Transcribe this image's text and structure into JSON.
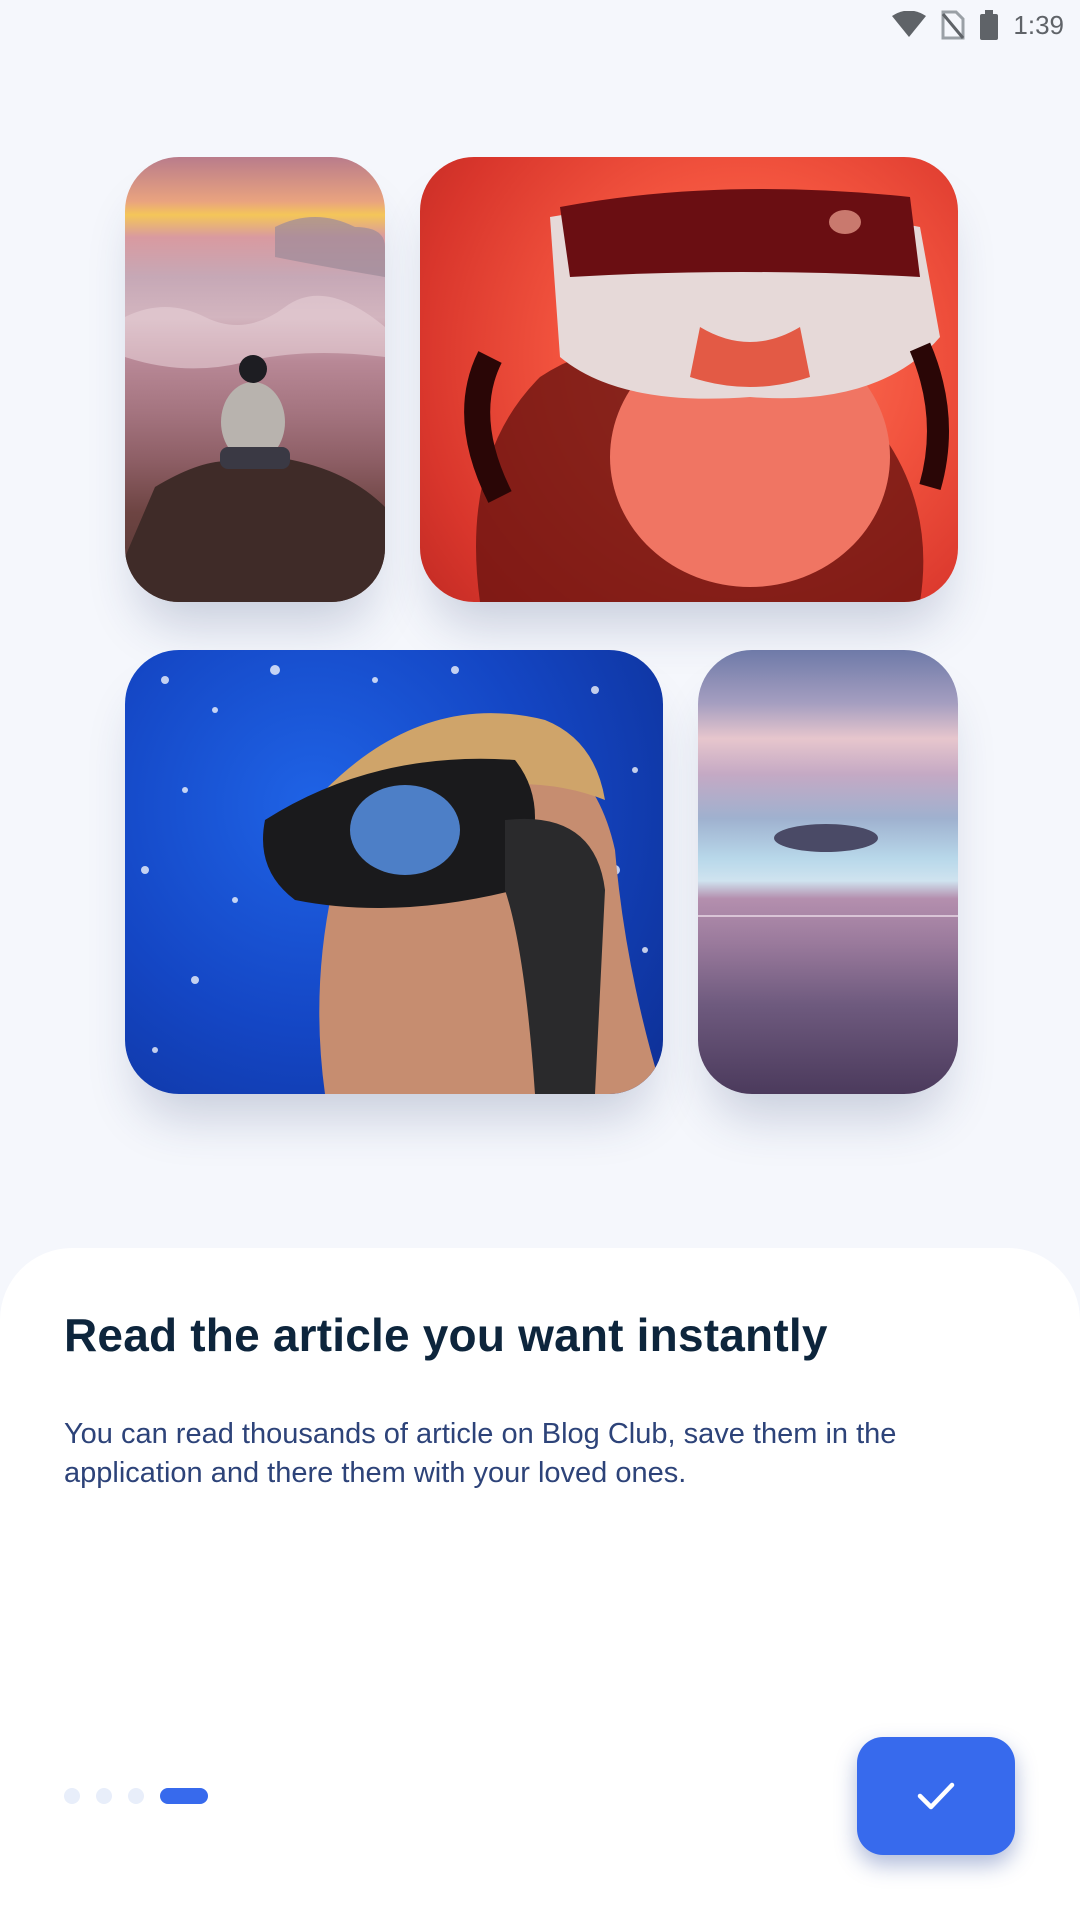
{
  "status_bar": {
    "time": "1:39",
    "icons": [
      "wifi-icon",
      "no-sim-icon",
      "battery-icon"
    ]
  },
  "collage": {
    "images": [
      {
        "name": "mountain-sunset-photo"
      },
      {
        "name": "vr-headset-photo"
      },
      {
        "name": "scuba-diver-photo"
      },
      {
        "name": "ocean-horizon-photo"
      }
    ]
  },
  "onboarding": {
    "title": "Read the article you want instantly",
    "description": "You can read thousands of article on Blog Club, save them in the application and there them with your loved ones."
  },
  "pager": {
    "total": 4,
    "current": 4
  },
  "done_button": {
    "icon": "check-icon"
  },
  "colors": {
    "accent": "#376aed",
    "title": "#0d253c",
    "body": "#2d4379",
    "background": "#f5f7fc",
    "inactive_dot": "#e8eefa"
  }
}
